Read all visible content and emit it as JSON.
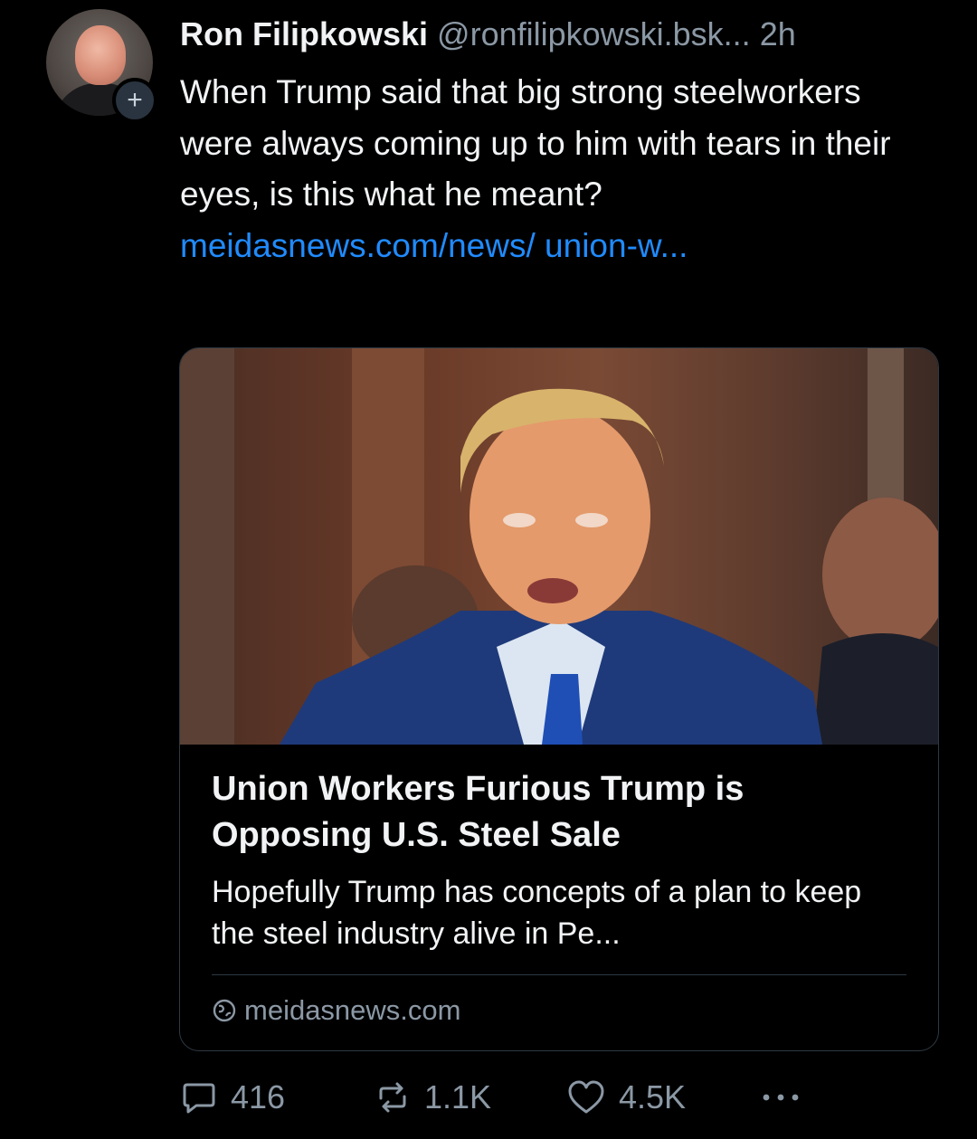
{
  "post": {
    "author": {
      "display_name": "Ron Filipkowski",
      "handle": "@ronfilipkowski.bsk...",
      "avatar_icon": "user-avatar",
      "follow_icon": "plus-icon",
      "follow_symbol": "+"
    },
    "time": "2h",
    "text": "When Trump said that big strong steelworkers were always coming up to him with tears in their eyes, is this what he meant? ",
    "link_text": "meidasnews.com/news/ union-w..."
  },
  "link_card": {
    "image_icon": "article-photo",
    "title": "Union Workers Furious Trump is Opposing U.S. Steel Sale",
    "description": "Hopefully Trump has concepts of a plan to keep the steel industry alive in Pe...",
    "domain": "meidasnews.com",
    "domain_icon": "globe-icon"
  },
  "actions": {
    "replies": "416",
    "reposts": "1.1K",
    "likes": "4.5K",
    "reply_icon": "comment-icon",
    "repost_icon": "repost-icon",
    "like_icon": "heart-icon",
    "more_icon": "more-options-icon"
  },
  "colors": {
    "background": "#000000",
    "text": "#f1f3f5",
    "muted": "#8b98a5",
    "link": "#208bfe",
    "border": "#2e3943"
  }
}
